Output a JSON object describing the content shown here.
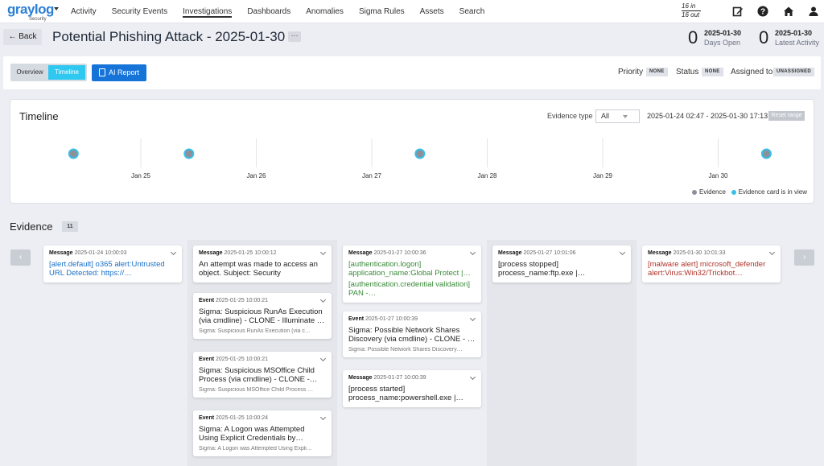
{
  "app": {
    "logo_word": "graylog",
    "logo_sub": "Security",
    "nav": [
      "Activity",
      "Security Events",
      "Investigations",
      "Dashboards",
      "Anomalies",
      "Sigma Rules",
      "Assets",
      "Search"
    ],
    "active_nav": "Investigations",
    "inout_top": "16 in",
    "inout_bottom": "16 out",
    "icons": [
      "edit-icon",
      "help-icon",
      "home-icon",
      "user-icon"
    ]
  },
  "header": {
    "back_label": "Back",
    "title": "Potential Phishing Attack - 2025-01-30",
    "more_label": "···",
    "stats": [
      {
        "value": "0",
        "date": "2025-01-30",
        "label": "Days Open"
      },
      {
        "value": "0",
        "date": "2025-01-30",
        "label": "Latest Activity"
      }
    ]
  },
  "toolbar": {
    "overview_label": "Overview",
    "timeline_label": "Timeline",
    "ai_report_label": "AI Report",
    "priority_label": "Priority",
    "priority_value": "NONE",
    "status_label": "Status",
    "status_value": "NONE",
    "assigned_label": "Assigned to",
    "assigned_value": "UNASSIGNED"
  },
  "timeline": {
    "title": "Timeline",
    "evidence_type_label": "Evidence type",
    "evidence_type_value": "All",
    "range_text": "2025-01-24 02:47 - 2025-01-30 17:13",
    "reset_label": "Reset range",
    "ticks": [
      "Jan 25",
      "Jan 26",
      "Jan 27",
      "Jan 28",
      "Jan 29",
      "Jan 30"
    ],
    "points": [
      {
        "date": "2025-01-24",
        "time": "10:00"
      },
      {
        "date": "2025-01-25",
        "time": "10:00"
      },
      {
        "date": "2025-01-27",
        "time": "10:00"
      },
      {
        "date": "2025-01-30",
        "time": "10:01"
      }
    ],
    "legend_evidence": "Evidence",
    "legend_in_view": "Evidence card is in view",
    "colors": {
      "evidence": "#8d8f99",
      "in_view": "#37c0e8"
    }
  },
  "evidence": {
    "heading": "Evidence",
    "count": "11",
    "prev_label": "‹",
    "next_label": "›",
    "columns": [
      [
        {
          "type": "Message",
          "ts": "2025-01-24 10:00:03",
          "body": "[alert.default] o365 alert:Untrusted URL Detected: https://…",
          "color": "blue"
        }
      ],
      [
        {
          "type": "Message",
          "ts": "2025-01-25 10:00:12",
          "body": "An attempt was made to access an object.  Subject: Security",
          "color": "dark"
        },
        {
          "type": "Event",
          "ts": "2025-01-25 10:00:21",
          "body": "Sigma: Suspicious RunAs Execution (via cmdline) - CLONE - Illuminate …",
          "sub": "Sigma: Suspicious RunAs Execution (via c…",
          "color": "dark"
        },
        {
          "type": "Event",
          "ts": "2025-01-25 10:00:21",
          "body": "Sigma: Suspicious MSOffice Child Process (via cmdline) - CLONE -…",
          "sub": "Sigma: Suspicious MSOffice Child Process …",
          "color": "dark"
        },
        {
          "type": "Event",
          "ts": "2025-01-25 10:00:24",
          "body": "Sigma: A Logon was Attempted Using Explicit Credentials by…",
          "sub": "Sigma: A Logon was Attempted Using Expli…",
          "color": "dark"
        }
      ],
      [
        {
          "type": "Message",
          "ts": "2025-01-27 10:00:36",
          "body": "[authentication.logon] application_name:Global Protect |…",
          "body2": "[authentication.credential validation] PAN -…",
          "color": "green"
        },
        {
          "type": "Event",
          "ts": "2025-01-27 10:00:39",
          "body": "Sigma: Possible Network Shares Discovery (via cmdline) - CLONE - …",
          "sub": "Sigma: Possible Network Shares Discovery…",
          "color": "dark"
        },
        {
          "type": "Message",
          "ts": "2025-01-27 10:00:39",
          "body": "[process started] process_name:powershell.exe |…",
          "color": "dark"
        }
      ],
      [
        {
          "type": "Message",
          "ts": "2025-01-27 10:01:06",
          "body": "[process stopped] process_name:ftp.exe |…",
          "color": "dark"
        }
      ],
      [
        {
          "type": "Message",
          "ts": "2025-01-30 10:01:33",
          "body": "[malware alert] microsoft_defender alert:Virus:Win32/Trickbot…",
          "color": "red"
        }
      ]
    ]
  }
}
